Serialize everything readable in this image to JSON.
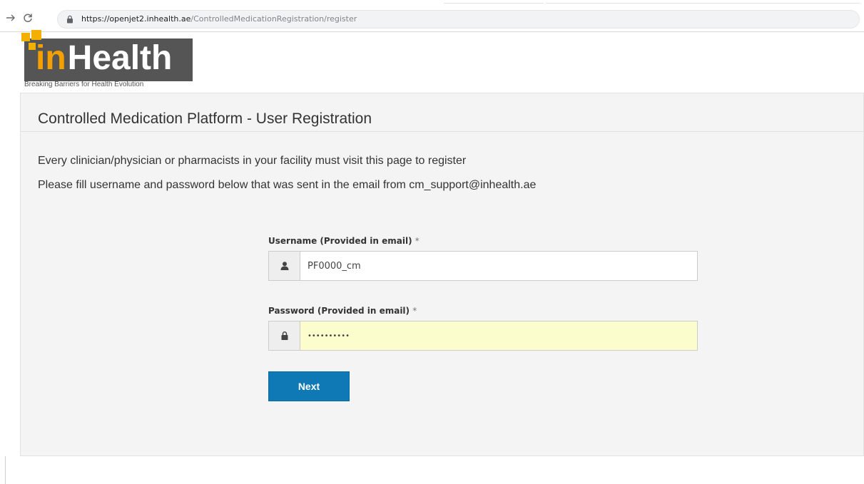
{
  "browser": {
    "back_icon": "arrow-right-icon",
    "reload_icon": "reload-icon",
    "url_host": "https://openjet2.inhealth.ae",
    "url_path": "/ControlledMedicationRegistration/register"
  },
  "logo": {
    "text_in": "in",
    "text_health": "Health",
    "tagline": "Breaking Barriers for Health Evolution",
    "colors": {
      "box": "#555555",
      "accent": "#f4a000"
    }
  },
  "page": {
    "title": "Controlled Medication Platform - User Registration",
    "intro_line_1": "Every clinician/physician or pharmacists in your facility must visit this page to register",
    "intro_line_2": "Please fill username and password below that was sent in the email from cm_support@inhealth.ae"
  },
  "form": {
    "username": {
      "label": "Username (Provided in email)",
      "required_mark": "*",
      "value": "PF0000_cm",
      "icon": "user-icon"
    },
    "password": {
      "label": "Password (Provided in email)",
      "required_mark": "*",
      "value": "••••••••••",
      "icon": "lock-icon"
    },
    "next_label": "Next"
  },
  "colors": {
    "primary_button": "#0f79b6",
    "panel_background": "#f4f4f4",
    "autofill_background": "#fbfdcc"
  }
}
